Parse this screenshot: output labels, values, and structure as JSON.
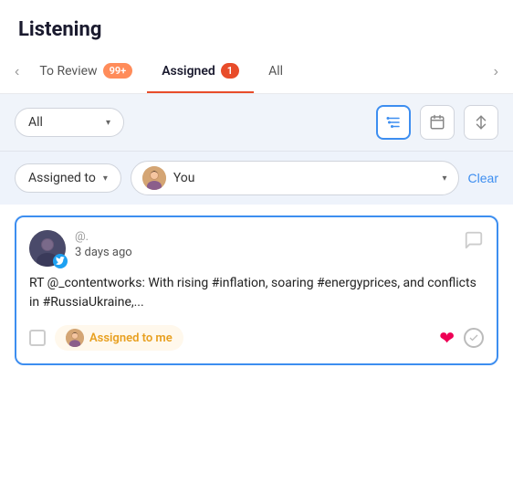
{
  "page": {
    "title": "Listening"
  },
  "tabs": {
    "nav_prev": "‹",
    "nav_next": "›",
    "items": [
      {
        "label": "To Review",
        "badge": "99+",
        "badge_type": "orange-light",
        "active": false
      },
      {
        "label": "Assigned",
        "badge": "1",
        "badge_type": "orange-dark",
        "active": true
      },
      {
        "label": "All",
        "badge": "",
        "badge_type": "",
        "active": false
      }
    ]
  },
  "filters": {
    "source_dropdown": "All",
    "chevron": "▾",
    "filter_icon": "⚙",
    "calendar_icon": "📅",
    "sort_icon": "⇅"
  },
  "assigned_filter": {
    "assigned_to_label": "Assigned to",
    "chevron": "▾",
    "you_label": "You",
    "clear_label": "Clear"
  },
  "post": {
    "handle": "@.",
    "time_ago": "3 days ago",
    "text": "RT @_contentworks: With rising #inflation, soaring #energyprices, and conflicts in #RussiaUkraine,...",
    "assigned_badge_label": "Assigned to me",
    "menu_icon": "☰"
  }
}
